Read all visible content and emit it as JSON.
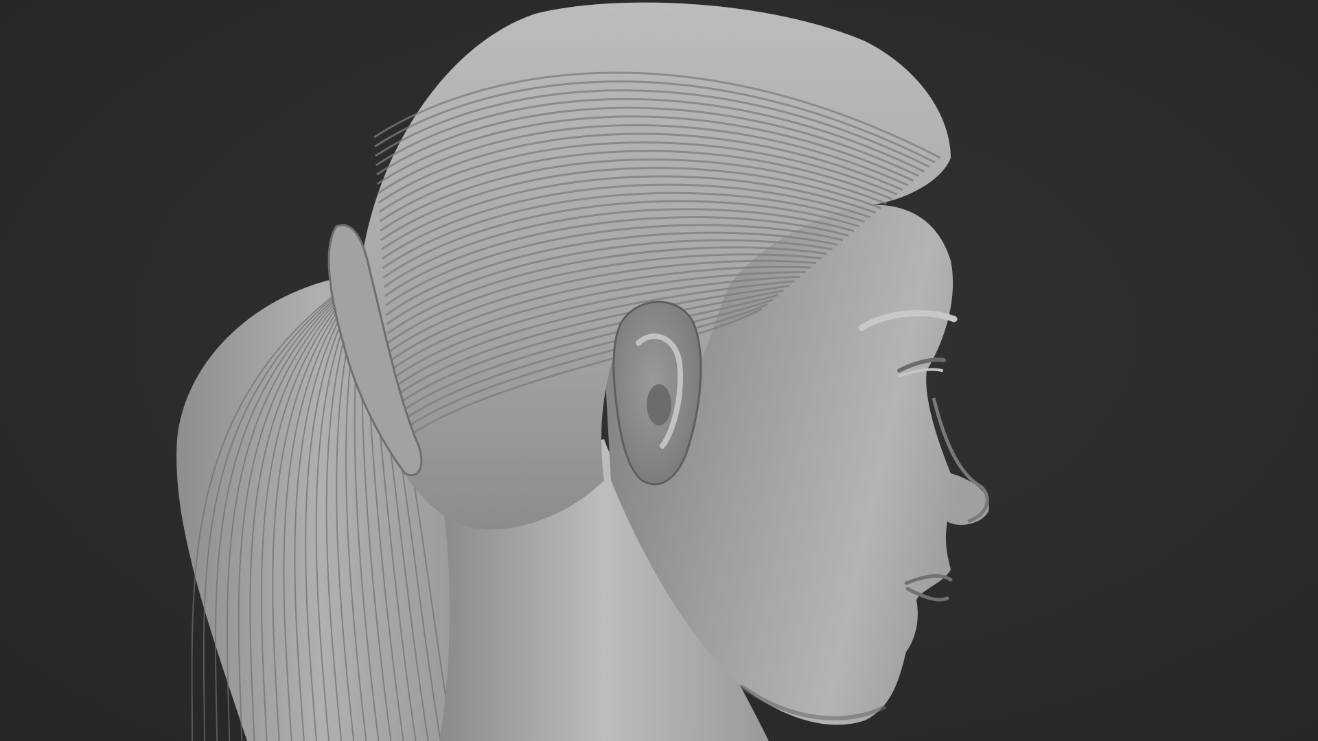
{
  "viewport": {
    "background_color": "#2c2c2c",
    "model_color": "#a8a8a8",
    "subject": "sculpted-head-profile",
    "hair_style": "ponytail",
    "facing": "right"
  }
}
